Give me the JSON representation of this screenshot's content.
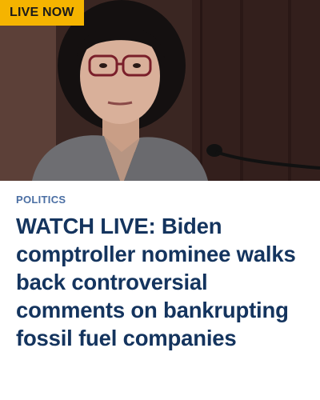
{
  "badge": {
    "label": "LIVE NOW",
    "color": "#f5b400"
  },
  "article": {
    "category": "POLITICS",
    "headline": "WATCH LIVE: Biden comptroller nominee walks back controversial comments on bankrupting fossil fuel companies",
    "category_color": "#4a6ea3",
    "headline_color": "#14345e"
  },
  "hero": {
    "icon": "news-photo"
  }
}
